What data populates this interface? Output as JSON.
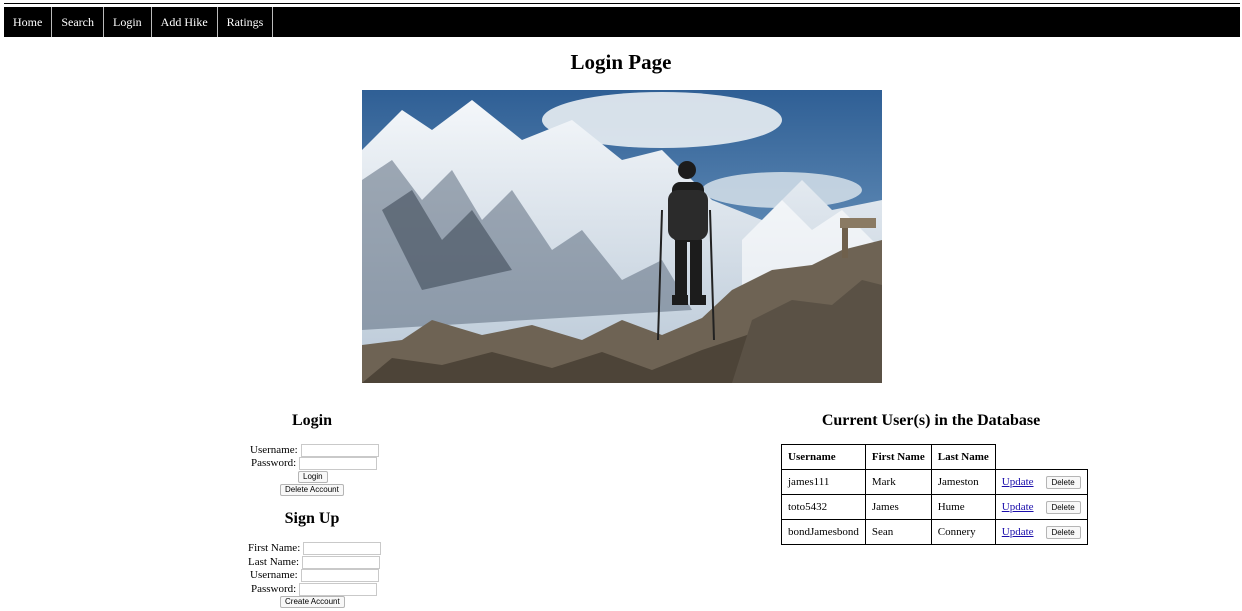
{
  "nav": {
    "items": [
      "Home",
      "Search",
      "Login",
      "Add Hike",
      "Ratings"
    ]
  },
  "page": {
    "title": "Login Page"
  },
  "hero": {
    "description": "hiker-on-mountain-photo"
  },
  "login": {
    "heading": "Login",
    "username_label": "Username:",
    "password_label": "Password:",
    "username_value": "",
    "password_value": "",
    "login_button": "Login",
    "delete_button": "Delete Account"
  },
  "signup": {
    "heading": "Sign Up",
    "first_name_label": "First Name:",
    "last_name_label": "Last Name:",
    "username_label": "Username:",
    "password_label": "Password:",
    "create_button": "Create Account"
  },
  "users": {
    "heading": "Current User(s) in the Database",
    "columns": [
      "Username",
      "First Name",
      "Last Name"
    ],
    "update_label": "Update",
    "delete_label": "Delete",
    "rows": [
      {
        "username": "james111",
        "first_name": "Mark",
        "last_name": "Jameston"
      },
      {
        "username": "toto5432",
        "first_name": "James",
        "last_name": "Hume"
      },
      {
        "username": "bondJamesbond",
        "first_name": "Sean",
        "last_name": "Connery"
      }
    ]
  },
  "colors": {
    "nav_bg": "#000000",
    "nav_text": "#ffffff",
    "link": "#1a0dab"
  }
}
